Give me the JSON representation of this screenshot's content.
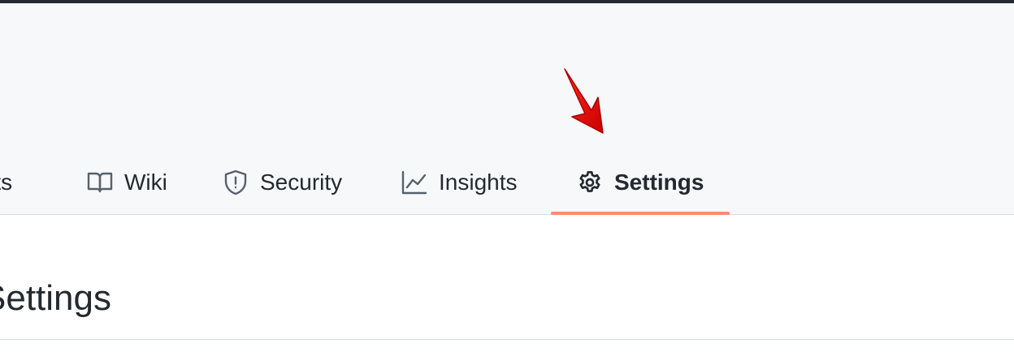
{
  "nav": {
    "tabs": [
      {
        "label": "ojects",
        "icon": "table-icon",
        "selected": false
      },
      {
        "label": "Wiki",
        "icon": "book-icon",
        "selected": false
      },
      {
        "label": "Security",
        "icon": "shield-icon",
        "selected": false
      },
      {
        "label": "Insights",
        "icon": "graph-icon",
        "selected": false
      },
      {
        "label": "Settings",
        "icon": "gear-icon",
        "selected": true
      }
    ],
    "accent_color": "#fd8c73"
  },
  "main": {
    "title": "Settings"
  },
  "annotation": {
    "pointer": "red-arrow-icon",
    "color": "#e00000"
  }
}
